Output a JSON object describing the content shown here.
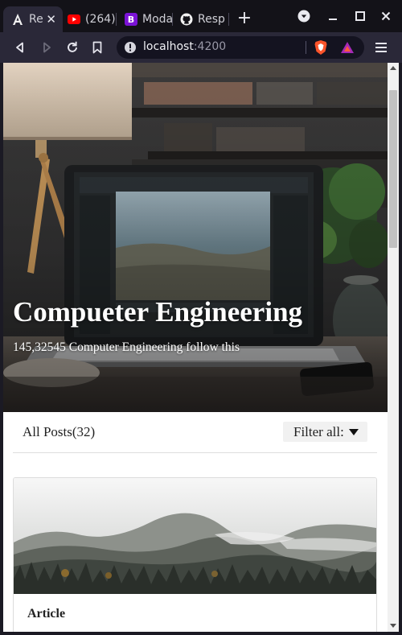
{
  "browser": {
    "tabs": [
      {
        "title": "Re",
        "icon": "angular-icon",
        "active": true
      },
      {
        "title": "(264)",
        "icon": "youtube-icon",
        "active": false
      },
      {
        "title": "Moda",
        "icon": "bootstrap-icon",
        "active": false
      },
      {
        "title": "Resp",
        "icon": "github-icon",
        "active": false
      }
    ],
    "bootstrap_glyph": "B",
    "url_host": "localhost",
    "url_port": ":4200",
    "colors": {
      "youtube": "#ff0000",
      "bootstrap": "#7b13d6",
      "brave": "#fb542b"
    }
  },
  "hero": {
    "title": "Compueter Engineering",
    "subtitle": "145,32545 Computer Engineering follow this"
  },
  "posts": {
    "count_label": "All Posts(32)",
    "filter_label": "Filter all:"
  },
  "card": {
    "label": "Article"
  }
}
